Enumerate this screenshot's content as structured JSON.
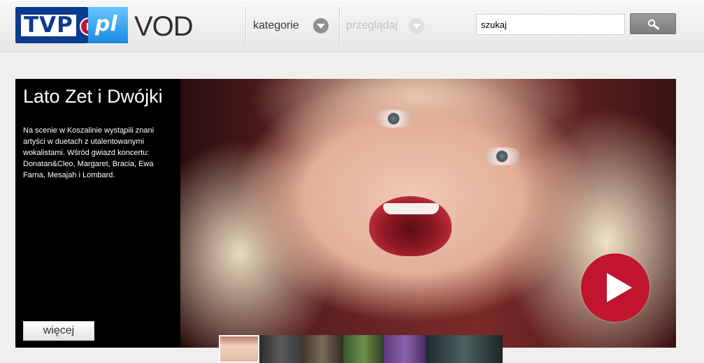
{
  "header": {
    "logo": {
      "brand_text": "TVP",
      "pl_text": "pl",
      "vod_text": "VOD"
    },
    "nav": [
      {
        "label": "kategorie",
        "state": "active"
      },
      {
        "label": "przeglądaj",
        "state": "disabled"
      }
    ],
    "search": {
      "value": "szukaj"
    }
  },
  "hero": {
    "title": "Lato Zet i Dwójki",
    "description": "Na scenie w Koszalinie wystąpili znani artyści w duetach z utalentowanymi wokalistami. Wśród gwiazd koncertu: Donatan&Cleo, Margaret, Bracia, Ewa Farna, Mesajah i Lombard.",
    "more_label": "więcej"
  },
  "colors": {
    "brand_blue": "#0b3b8f",
    "accent_red": "#c0142f",
    "light_blue": "#1b89e0"
  },
  "icons": {
    "search": "magnifier-icon",
    "chevron": "chevron-down-icon",
    "play": "play-icon"
  }
}
